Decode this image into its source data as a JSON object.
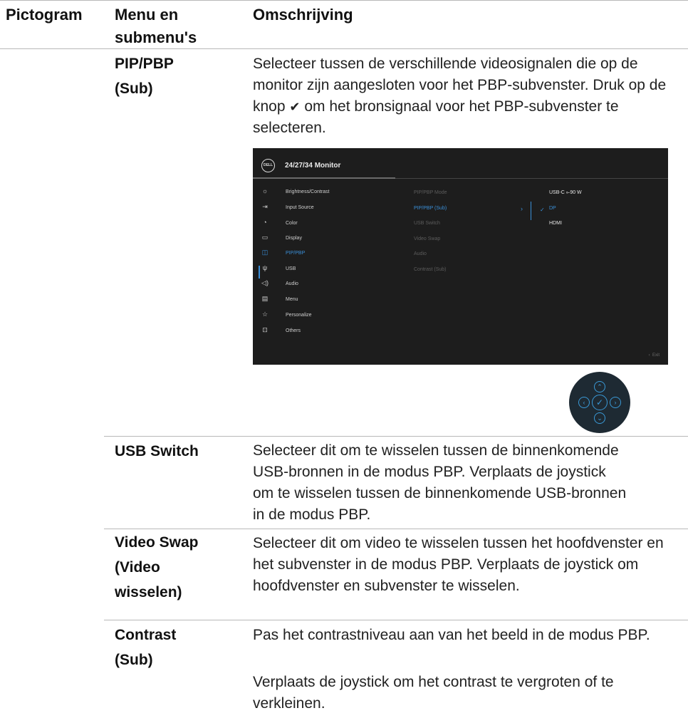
{
  "headers": {
    "icon": "Pictogram",
    "menu": "Menu en submenu's",
    "desc": "Omschrijving"
  },
  "rows": [
    {
      "term": "PIP/PBP (Sub)",
      "desc_before": "Selecteer tussen de verschillende videosignalen die op de monitor zijn aangesloten voor het PBP-subvenster. Druk op de knop",
      "desc_icon": "check-icon",
      "desc_after": "om het bronsignaal voor het PBP-subvenster te selecteren."
    },
    {
      "term": "USB Switch",
      "desc": "Selecteer dit om te wisselen tussen de binnenkomende USB-bronnen in de modus PBP. Verplaats de joystick om te wisselen tussen de binnenkomende USB-bronnen in de modus PBP."
    },
    {
      "term": "Video Swap (Video wisselen)",
      "desc": "Selecteer dit om video te wisselen tussen het hoofdvenster en het subvenster in de modus PBP. Verplaats de joystick om hoofdvenster en subvenster te wisselen."
    },
    {
      "term": "Contrast (Sub)",
      "desc": "Pas het contrastniveau aan van het beeld in de modus PBP.",
      "desc2": "Verplaats de joystick om het contrast te vergroten of te verkleinen."
    }
  ],
  "osd": {
    "logo": "DELL",
    "title": "24/27/34 Monitor",
    "menu": [
      {
        "icon": "brightness-icon",
        "label": "Brightness/Contrast"
      },
      {
        "icon": "input-source-icon",
        "label": "Input Source"
      },
      {
        "icon": "color-icon",
        "label": "Color"
      },
      {
        "icon": "display-icon",
        "label": "Display"
      },
      {
        "icon": "pip-pbp-icon",
        "label": "PIP/PBP"
      },
      {
        "icon": "usb-icon",
        "label": "USB"
      },
      {
        "icon": "audio-icon",
        "label": "Audio"
      },
      {
        "icon": "menu-icon",
        "label": "Menu"
      },
      {
        "icon": "star-icon",
        "label": "Personalize"
      },
      {
        "icon": "others-icon",
        "label": "Others"
      }
    ],
    "active_menu": "PIP/PBP",
    "submenu": [
      "PIP/PBP Mode",
      "PIP/PBP (Sub)",
      "USB Switch",
      "Video Swap",
      "Audio",
      "Contrast (Sub)"
    ],
    "selected_submenu": "PIP/PBP (Sub)",
    "options": [
      "USB-C ⟜90 W",
      "DP",
      "HDMI"
    ],
    "selected_option": "DP",
    "exit": "Exit",
    "colors": {
      "background": "#1d1d1d",
      "accent": "#3a8fd8"
    }
  },
  "joystick": {
    "buttons": [
      "up-icon",
      "left-icon",
      "check-icon",
      "right-icon",
      "down-icon"
    ]
  }
}
